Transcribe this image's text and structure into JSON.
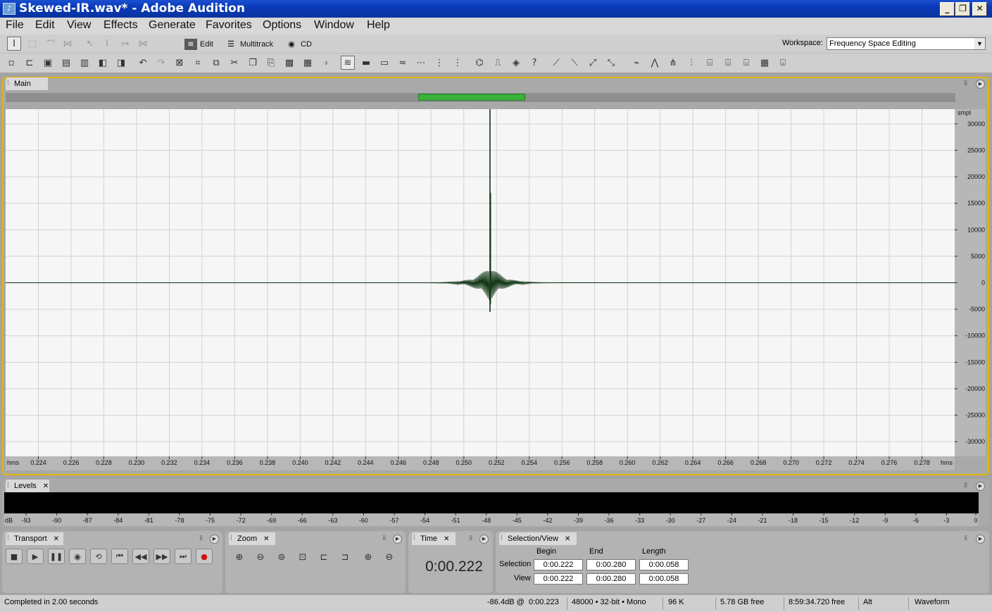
{
  "window": {
    "title": "Skewed-IR.wav* - Adobe Audition"
  },
  "menu": [
    "File",
    "Edit",
    "View",
    "Effects",
    "Generate",
    "Favorites",
    "Options",
    "Window",
    "Help"
  ],
  "modes": [
    {
      "label": "Edit",
      "icon": "waveform-edit-icon",
      "active": true
    },
    {
      "label": "Multitrack",
      "icon": "multitrack-icon",
      "active": false
    },
    {
      "label": "CD",
      "icon": "cd-icon",
      "active": false
    }
  ],
  "workspace": {
    "label": "Workspace:",
    "value": "Frequency Space Editing"
  },
  "main_panel": {
    "tab": "Main",
    "amplitude_unit": "smpl",
    "amplitude_ticks": [
      "30000",
      "25000",
      "20000",
      "15000",
      "10000",
      "5000",
      "0",
      "-5000",
      "-10000",
      "-15000",
      "-20000",
      "-25000",
      "-30000"
    ],
    "time_unit": "hms",
    "time_ticks": [
      "0.224",
      "0.226",
      "0.228",
      "0.230",
      "0.232",
      "0.234",
      "0.236",
      "0.238",
      "0.240",
      "0.242",
      "0.244",
      "0.246",
      "0.248",
      "0.250",
      "0.252",
      "0.254",
      "0.256",
      "0.258",
      "0.260",
      "0.262",
      "0.264",
      "0.266",
      "0.268",
      "0.270",
      "0.272",
      "0.274",
      "0.276",
      "0.278"
    ],
    "view_start": 0.222,
    "view_end": 0.28,
    "overview_range": [
      0.4343,
      0.5471
    ],
    "peak_time": 0.2516,
    "colors": {
      "waveform": "#0e3312",
      "grid": "#d2d2d2",
      "background": "#f6f6f6",
      "panel_border": "#e6b400"
    }
  },
  "levels_panel": {
    "tab": "Levels",
    "unit": "dB",
    "ticks": [
      "-93",
      "-90",
      "-87",
      "-84",
      "-81",
      "-78",
      "-75",
      "-72",
      "-69",
      "-66",
      "-63",
      "-60",
      "-57",
      "-54",
      "-51",
      "-48",
      "-45",
      "-42",
      "-39",
      "-36",
      "-33",
      "-30",
      "-27",
      "-24",
      "-21",
      "-18",
      "-15",
      "-12",
      "-9",
      "-6",
      "-3",
      "0"
    ]
  },
  "transport_panel": {
    "tab": "Transport"
  },
  "zoom_panel": {
    "tab": "Zoom"
  },
  "time_panel": {
    "tab": "Time",
    "value": "0:00.222"
  },
  "selection_panel": {
    "tab": "Selection/View",
    "headers": [
      "Begin",
      "End",
      "Length"
    ],
    "selection": {
      "label": "Selection",
      "begin": "0:00.222",
      "end": "0:00.280",
      "length": "0:00.058"
    },
    "view": {
      "label": "View",
      "begin": "0:00.222",
      "end": "0:00.280",
      "length": "0:00.058"
    }
  },
  "status": {
    "message": "Completed in 2.00 seconds",
    "cursor_level": "-86.4dB @",
    "cursor_time": "0:00.223",
    "format": "48000 • 32-bit • Mono",
    "size": "96 K",
    "disk_free": "5.78 GB free",
    "time_free": "8:59:34.720 free",
    "modifier": "Alt",
    "view_mode": "Waveform"
  }
}
